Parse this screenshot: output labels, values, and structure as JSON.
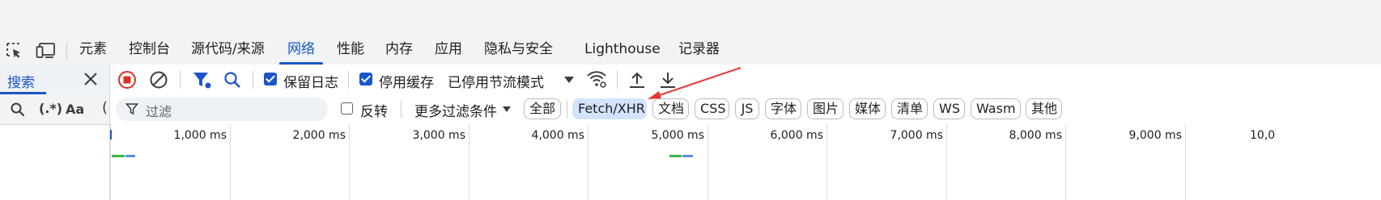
{
  "tabs": [
    {
      "label": "元素",
      "active": false
    },
    {
      "label": "控制台",
      "active": false
    },
    {
      "label": "源代码/来源",
      "active": false
    },
    {
      "label": "网络",
      "active": true
    },
    {
      "label": "性能",
      "active": false
    },
    {
      "label": "内存",
      "active": false
    },
    {
      "label": "应用",
      "active": false
    },
    {
      "label": "隐私与安全",
      "active": false
    },
    {
      "label": "Lighthouse",
      "active": false
    },
    {
      "label": "记录器",
      "active": false
    }
  ],
  "sidebar": {
    "title": "搜索",
    "regex_label": "(.*)",
    "case_label": "Aa"
  },
  "toolbar": {
    "preserve_log": {
      "label": "保留日志",
      "checked": true
    },
    "disable_cache": {
      "label": "停用缓存",
      "checked": true
    },
    "throttling": {
      "value": "已停用节流模式"
    }
  },
  "filter": {
    "placeholder": "过滤",
    "invert": {
      "label": "反转",
      "checked": false
    },
    "more_filters": "更多过滤条件",
    "chips": [
      {
        "label": "全部",
        "selected": false
      },
      {
        "label": "Fetch/XHR",
        "selected": true
      },
      {
        "label": "文档",
        "selected": false
      },
      {
        "label": "CSS",
        "selected": false
      },
      {
        "label": "JS",
        "selected": false
      },
      {
        "label": "字体",
        "selected": false
      },
      {
        "label": "图片",
        "selected": false
      },
      {
        "label": "媒体",
        "selected": false
      },
      {
        "label": "清单",
        "selected": false
      },
      {
        "label": "WS",
        "selected": false
      },
      {
        "label": "Wasm",
        "selected": false
      },
      {
        "label": "其他",
        "selected": false
      }
    ]
  },
  "timeline": {
    "ticks": [
      "1,000 ms",
      "2,000 ms",
      "3,000 ms",
      "4,000 ms",
      "5,000 ms",
      "6,000 ms",
      "7,000 ms",
      "8,000 ms",
      "9,000 ms",
      "10,0"
    ]
  },
  "colors": {
    "accent": "#1a56c7",
    "record_red": "#d93025",
    "bar_green": "#3bb54a",
    "bar_blue": "#5b8fe6",
    "annotation_red": "#e53935"
  }
}
